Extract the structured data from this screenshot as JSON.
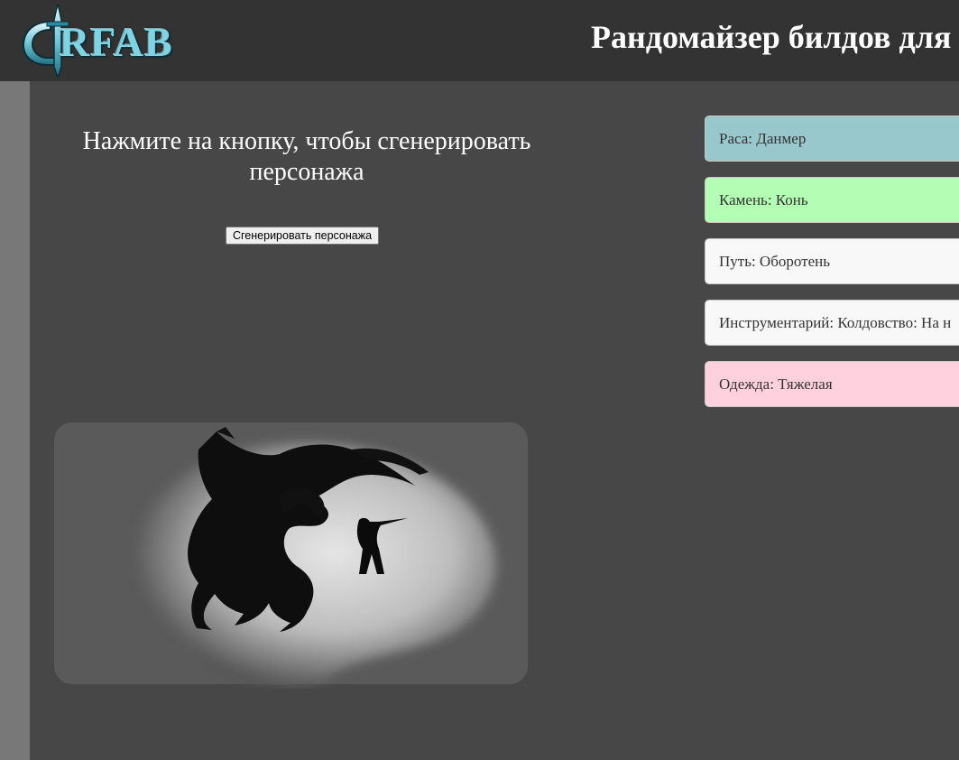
{
  "header": {
    "logo_text": "RFAB",
    "title": "Рандомайзер билдов для"
  },
  "main": {
    "prompt": "Нажмите на кнопку, чтобы сгенерировать персонажа",
    "generate_button": "Сгенерировать персонажа"
  },
  "results": [
    {
      "label": "Раса: Данмер",
      "color": "#98c7cc"
    },
    {
      "label": "Камень: Конь",
      "color": "#b4fdb4"
    },
    {
      "label": "Путь: Оборотень",
      "color": "#f8f8f8"
    },
    {
      "label": "Инструментарий: Колдовство: На н",
      "color": "#f8f8f8"
    },
    {
      "label": "Одежда: Тяжелая",
      "color": "#ffd1df"
    }
  ],
  "colors": {
    "header_bg": "#333333",
    "page_bg": "#474747",
    "sidebar_strip": "#787878"
  },
  "icons": {
    "logo": "rfab-sword-logo",
    "illustration": "dragon-vs-warrior-silhouette"
  }
}
